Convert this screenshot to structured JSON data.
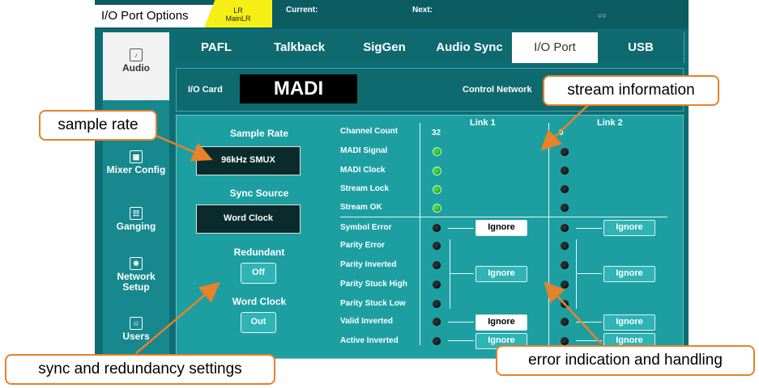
{
  "header": {
    "title": "I/O Port Options",
    "lr_tag_line1": "LR",
    "lr_tag_line2": "MainLR",
    "current_label": "Current:",
    "next_label": "Next:",
    "indicator": "○○"
  },
  "sidebar": {
    "items": [
      {
        "label": "Audio",
        "icon": "speaker-icon"
      },
      {
        "label": "Mixer Config",
        "icon": "mixer-config-icon"
      },
      {
        "label": "Ganging",
        "icon": "ganging-icon"
      },
      {
        "label": "Network Setup",
        "icon": "network-setup-icon"
      },
      {
        "label": "Users",
        "icon": "users-icon"
      }
    ]
  },
  "tabs": [
    "PAFL",
    "Talkback",
    "SigGen",
    "Audio Sync",
    "I/O Port",
    "USB"
  ],
  "active_tab": "I/O Port",
  "io_card": {
    "label": "I/O Card",
    "value": "MADI",
    "control_network_label": "Control Network"
  },
  "settings": {
    "sample_rate_label": "Sample Rate",
    "sample_rate_value": "96kHz  SMUX",
    "sync_source_label": "Sync Source",
    "sync_source_value": "Word Clock",
    "redundant_label": "Redundant",
    "redundant_value": "Off",
    "word_clock_label": "Word Clock",
    "word_clock_value": "Out"
  },
  "status": {
    "link1_label": "Link 1",
    "link2_label": "Link 2",
    "channel_count_label": "Channel Count",
    "link1_channel_count": "32",
    "link2_channel_count": "0",
    "rows": [
      {
        "label": "MADI Signal",
        "link1": "green",
        "link2": "off"
      },
      {
        "label": "MADI Clock",
        "link1": "green",
        "link2": "off"
      },
      {
        "label": "Stream Lock",
        "link1": "green",
        "link2": "off"
      },
      {
        "label": "Stream OK",
        "link1": "green",
        "link2": "off"
      },
      {
        "label": "Symbol Error",
        "link1": "off",
        "link2": "off"
      },
      {
        "label": "Parity Error",
        "link1": "off",
        "link2": "off"
      },
      {
        "label": "Parity Inverted",
        "link1": "off",
        "link2": "off"
      },
      {
        "label": "Parity Stuck High",
        "link1": "off",
        "link2": "off"
      },
      {
        "label": "Parity Stuck Low",
        "link1": "off",
        "link2": "off"
      },
      {
        "label": "Valid Inverted",
        "link1": "off",
        "link2": "off"
      },
      {
        "label": "Active Inverted",
        "link1": "off",
        "link2": "off"
      }
    ],
    "ignore_label": "Ignore"
  },
  "callouts": {
    "sample_rate": "sample rate",
    "stream_info": "stream information",
    "sync_redundancy": "sync and redundancy settings",
    "error_handling": "error indication and handling"
  },
  "colors": {
    "accent_orange": "#e5822a",
    "tag_yellow": "#f5ef16",
    "led_green": "#3fd63a",
    "panel_teal": "#1d9fa2"
  }
}
